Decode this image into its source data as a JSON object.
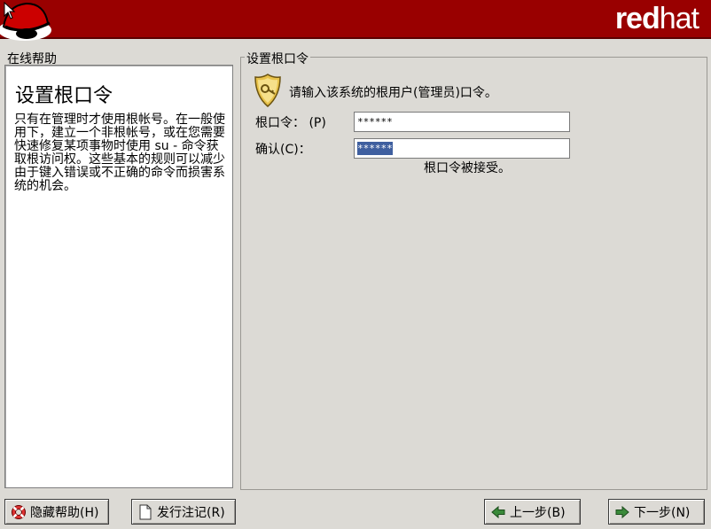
{
  "banner": {
    "brand_bold": "red",
    "brand_thin": "hat"
  },
  "help": {
    "pane_title": "在线帮助",
    "heading": "设置根口令",
    "body": "只有在管理时才使用根帐号。在一般使用下，建立一个非根帐号，或在您需要快速修复某项事物时使用 su - 命令获取根访问权。这些基本的规则可以减少由于键入错误或不正确的命令而损害系统的机会。"
  },
  "root_password": {
    "group_title": "设置根口令",
    "prompt": "请输入该系统的根用户(管理员)口令。",
    "password_label": "根口令：  (P)",
    "confirm_label": "确认(C)：",
    "password_value": "******",
    "confirm_value": "******",
    "accepted_message": "根口令被接受。"
  },
  "buttons": {
    "hide_help": "隐藏帮助(H)",
    "release_notes": "发行注记(R)",
    "back": "上一步(B)",
    "next": "下一步(N)"
  },
  "colors": {
    "banner": "#990000",
    "background": "#dcdad5",
    "selection": "#3f5f9f"
  },
  "icons": [
    "redhat-hat-logo",
    "shield-key-icon",
    "lifebuoy-icon",
    "document-icon",
    "arrow-left-icon",
    "arrow-right-icon",
    "mouse-cursor"
  ]
}
